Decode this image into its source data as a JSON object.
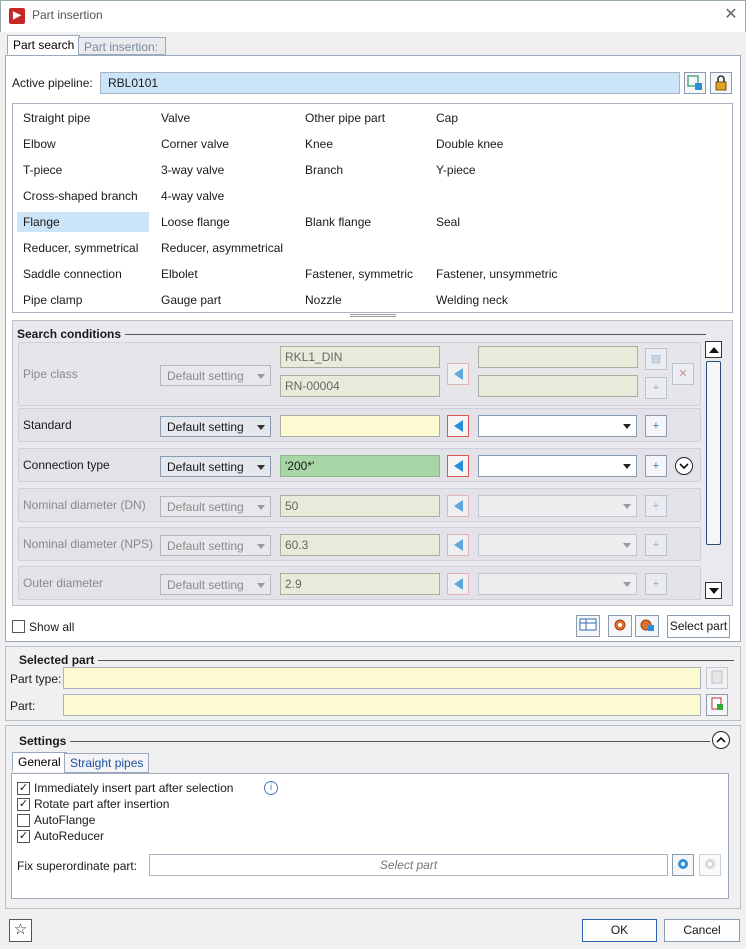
{
  "window": {
    "title": "Part insertion"
  },
  "tabs": {
    "part_search": "Part search",
    "part_insertion": "Part insertion:"
  },
  "pipeline": {
    "label": "Active pipeline:",
    "value": "RBL0101"
  },
  "categories": [
    [
      "Straight pipe",
      "Valve",
      "Other pipe part",
      "Cap"
    ],
    [
      "Elbow",
      "Corner valve",
      "Knee",
      "Double knee"
    ],
    [
      "T-piece",
      "3-way valve",
      "Branch",
      "Y-piece"
    ],
    [
      "Cross-shaped branch",
      "4-way valve",
      "",
      ""
    ],
    [
      "Flange",
      "Loose flange",
      "Blank flange",
      "Seal"
    ],
    [
      "Reducer, symmetrical",
      "Reducer, asymmetrical",
      "",
      ""
    ],
    [
      "Saddle connection",
      "Elbolet",
      "Fastener, symmetric",
      "Fastener, unsymmetric"
    ],
    [
      "Pipe clamp",
      "Gauge part",
      "Nozzle",
      "Welding neck"
    ]
  ],
  "selected_category": "Flange",
  "search": {
    "title": "Search conditions",
    "rows": [
      {
        "label": "Pipe class",
        "mode": "Default setting",
        "value": "RKL1_DIN",
        "value2": "RN-00004",
        "enabled": false
      },
      {
        "label": "Standard",
        "mode": "Default setting",
        "value": "",
        "enabled": true
      },
      {
        "label": "Connection type",
        "mode": "Default setting",
        "value": "'200*'",
        "enabled": true
      },
      {
        "label": "Nominal diameter (DN)",
        "mode": "Default setting",
        "value": "50",
        "enabled": false
      },
      {
        "label": "Nominal diameter (NPS)",
        "mode": "Default setting",
        "value": "60.3",
        "enabled": false
      },
      {
        "label": "Outer diameter",
        "mode": "Default setting",
        "value": "2.9",
        "enabled": false
      }
    ],
    "show_all": "Show all",
    "select_part": "Select part"
  },
  "selected_part": {
    "title": "Selected part",
    "part_type_label": "Part type:",
    "part_label": "Part:"
  },
  "settings": {
    "title": "Settings",
    "tabs": {
      "general": "General",
      "straight_pipes": "Straight pipes"
    },
    "options": [
      {
        "label": "Immediately insert part after selection",
        "checked": true
      },
      {
        "label": "Rotate part after insertion",
        "checked": true
      },
      {
        "label": "AutoFlange",
        "checked": false
      },
      {
        "label": "AutoReducer",
        "checked": true
      }
    ],
    "fix_label": "Fix superordinate part:",
    "fix_placeholder": "Select part"
  },
  "footer": {
    "ok": "OK",
    "cancel": "Cancel"
  },
  "colors": {
    "accent": "#2b8fd6",
    "selection": "#cce4f7",
    "highlight_green": "#a8d5a5",
    "input_yellow": "#fdfbd2"
  }
}
